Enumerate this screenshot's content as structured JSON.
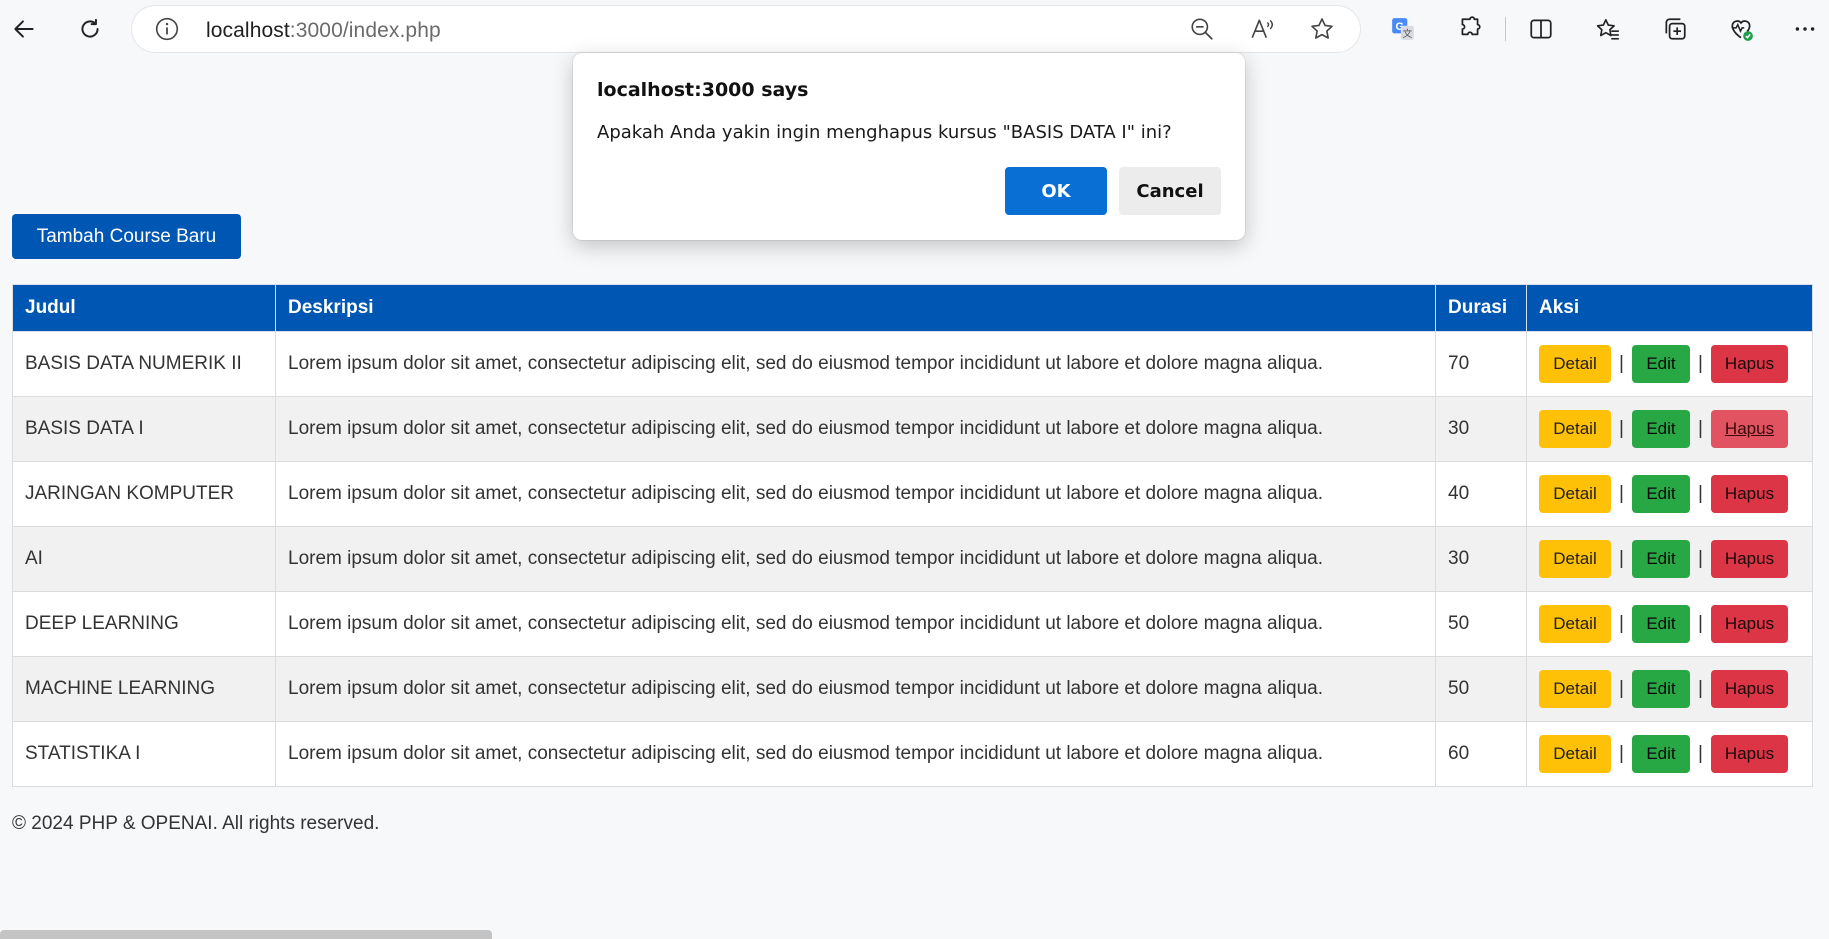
{
  "browser": {
    "url_host": "localhost",
    "url_rest": ":3000/index.php",
    "icons": [
      "back-icon",
      "refresh-icon",
      "info-icon",
      "zoom-out-icon",
      "read-aloud-icon",
      "favorite-star-icon",
      "translate-icon",
      "extensions-icon",
      "split-screen-icon",
      "favorites-icon",
      "collections-icon",
      "browser-essentials-icon",
      "more-icon"
    ]
  },
  "page": {
    "add_button": "Tambah Course Baru",
    "table": {
      "headers": [
        "Judul",
        "Deskripsi",
        "Durasi",
        "Aksi"
      ],
      "rows": [
        {
          "judul": "BASIS DATA NUMERIK II",
          "deskripsi": "Lorem ipsum dolor sit amet, consectetur adipiscing elit, sed do eiusmod tempor incididunt ut labore et dolore magna aliqua.",
          "durasi": "70"
        },
        {
          "judul": "BASIS DATA I",
          "deskripsi": "Lorem ipsum dolor sit amet, consectetur adipiscing elit, sed do eiusmod tempor incididunt ut labore et dolore magna aliqua.",
          "durasi": "30"
        },
        {
          "judul": "JARINGAN KOMPUTER",
          "deskripsi": "Lorem ipsum dolor sit amet, consectetur adipiscing elit, sed do eiusmod tempor incididunt ut labore et dolore magna aliqua.",
          "durasi": "40"
        },
        {
          "judul": "AI",
          "deskripsi": "Lorem ipsum dolor sit amet, consectetur adipiscing elit, sed do eiusmod tempor incididunt ut labore et dolore magna aliqua.",
          "durasi": "30"
        },
        {
          "judul": "DEEP LEARNING",
          "deskripsi": "Lorem ipsum dolor sit amet, consectetur adipiscing elit, sed do eiusmod tempor incididunt ut labore et dolore magna aliqua.",
          "durasi": "50"
        },
        {
          "judul": "MACHINE LEARNING",
          "deskripsi": "Lorem ipsum dolor sit amet, consectetur adipiscing elit, sed do eiusmod tempor incididunt ut labore et dolore magna aliqua.",
          "durasi": "50"
        },
        {
          "judul": "STATISTIKA I",
          "deskripsi": "Lorem ipsum dolor sit amet, consectetur adipiscing elit, sed do eiusmod tempor incididunt ut labore et dolore magna aliqua.",
          "durasi": "60"
        }
      ],
      "actions": {
        "detail": "Detail",
        "edit": "Edit",
        "hapus": "Hapus",
        "separator": "|"
      }
    },
    "footer": "© 2024 PHP & OPENAI. All rights reserved."
  },
  "dialog": {
    "title": "localhost:3000 says",
    "message": "Apakah Anda yakin ingin menghapus kursus \"BASIS DATA I\" ini?",
    "ok": "OK",
    "cancel": "Cancel"
  },
  "colors": {
    "primary": "#0056b3",
    "detail": "#ffc107",
    "edit": "#28a745",
    "hapus": "#dc3545",
    "dialog_ok": "#0a6fd4"
  }
}
